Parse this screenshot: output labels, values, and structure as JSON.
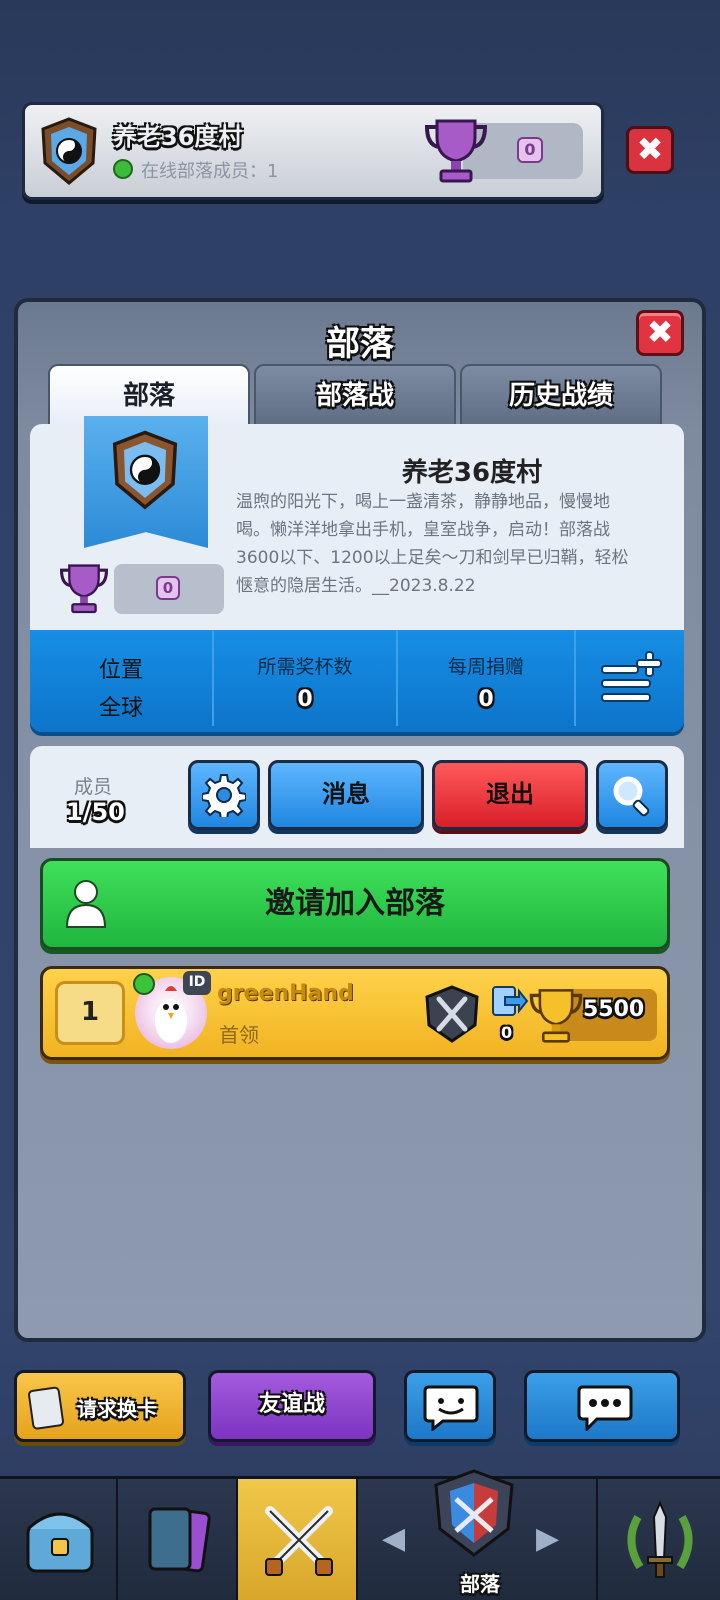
{
  "top_banner": {
    "clan_name": "养老36度村",
    "online_label": "在线部落成员：1",
    "trophies": "0",
    "close_icon": "close-icon"
  },
  "panel": {
    "title": "部落",
    "tabs": [
      {
        "label": "部落",
        "active": true
      },
      {
        "label": "部落战",
        "active": false
      },
      {
        "label": "历史战绩",
        "active": false
      }
    ]
  },
  "clan": {
    "name": "养老36度村",
    "description": "温煦的阳光下，喝上一盏清茶，静静地品，慢慢地喝。懒洋洋地拿出手机，皇室战争，启动！部落战3600以下、1200以上足矣～刀和剑早已归鞘，轻松惬意的隐居生活。__2023.8.22",
    "trophies": "0"
  },
  "stats": {
    "location_label": "位置",
    "location_value": "全球",
    "required_label": "所需奖杯数",
    "required_value": "0",
    "donations_label": "每周捐赠",
    "donations_value": "0"
  },
  "members": {
    "label": "成员",
    "count": "1/50",
    "message_label": "消息",
    "leave_label": "退出"
  },
  "invite": {
    "label": "邀请加入部落"
  },
  "member_list": [
    {
      "rank": "1",
      "name": "greenHand",
      "role": "首领",
      "id_badge": "ID",
      "donations": "0",
      "trophies": "5500"
    }
  ],
  "actions": {
    "request_label": "请求换卡",
    "friendly_label": "友谊战"
  },
  "nav": {
    "items": [
      "shop-icon",
      "cards-icon",
      "battle-icon",
      "clan-icon",
      "events-icon"
    ],
    "clan_label": "部落"
  },
  "colors": {
    "accent_blue": "#168ee5",
    "accent_green": "#2fcf4c",
    "accent_red": "#e03440",
    "accent_gold": "#ffd24a"
  }
}
